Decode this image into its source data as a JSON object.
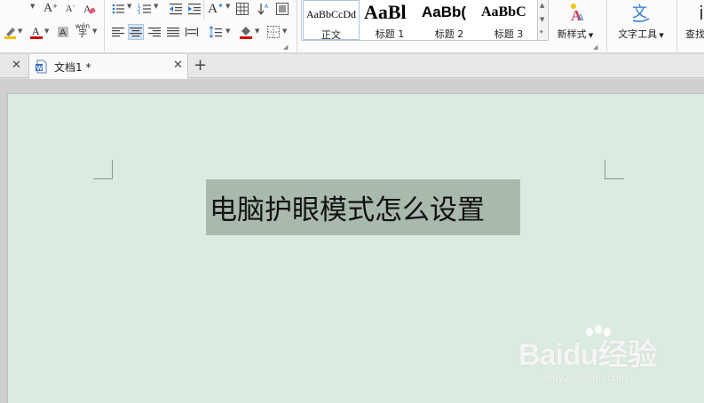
{
  "ribbon": {
    "font_grow": "A",
    "font_shrink": "A",
    "phonetic_guide": "wén",
    "text_effect": "A",
    "styles": [
      {
        "preview": "AaBbCcDd",
        "name": "正文"
      },
      {
        "preview": "AaBl",
        "name": "标题 1"
      },
      {
        "preview": "AaBb(",
        "name": "标题 2"
      },
      {
        "preview": "AaBbC",
        "name": "标题 3"
      }
    ],
    "new_style": "新样式",
    "text_tools": "文字工具",
    "find_replace": "查找",
    "text_tools_glyph": "文"
  },
  "tabs": {
    "doc_tab_label": "文档1 *",
    "close_glyph": "✕",
    "new_tab_glyph": "+"
  },
  "document": {
    "heading": "电脑护眼模式怎么设置"
  },
  "watermark": {
    "brand": "Baidu经验",
    "url": "jingyan.baidu.com"
  },
  "colors": {
    "page_background": "#dbebe0",
    "selection_highlight": "#a9b9ac",
    "font_color_red": "#d00000",
    "highlight_yellow": "#f3c400",
    "text_effect_blue": "#2a7ad9"
  }
}
